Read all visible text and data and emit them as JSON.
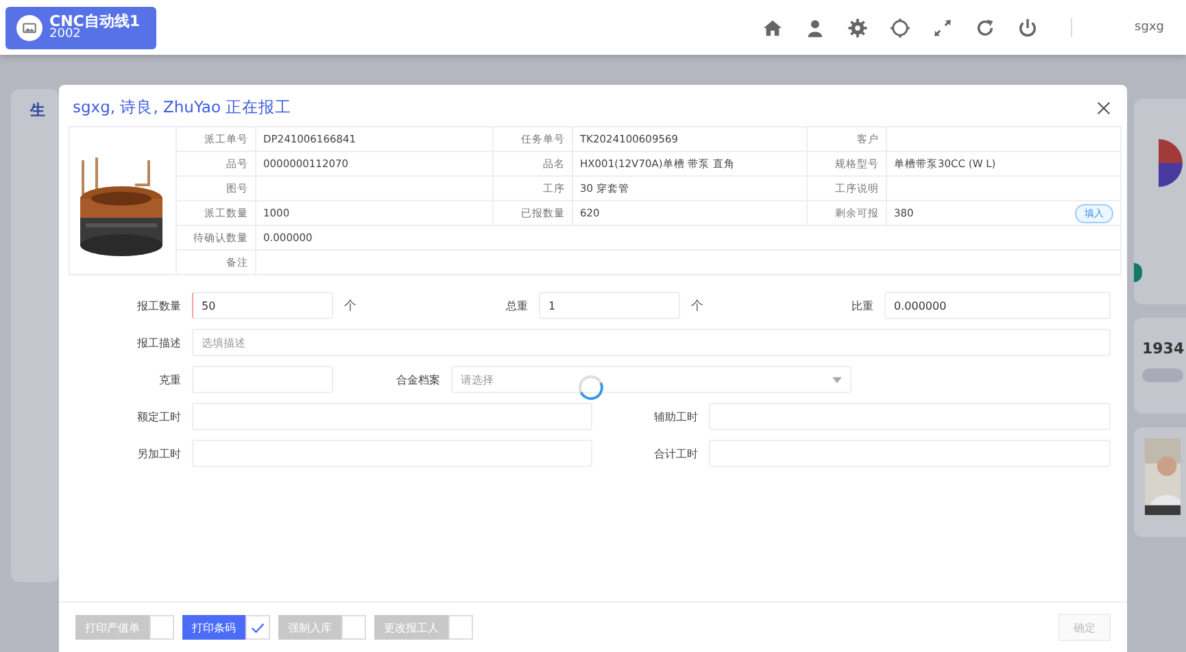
{
  "header": {
    "title": "CNC自动线1",
    "subtitle": "2002",
    "user": "sgxg"
  },
  "background": {
    "left_heading": "生",
    "right_reading": "1934"
  },
  "dialog": {
    "title": "sgxg, 诗良, ZhuYao 正在报工",
    "loading": true,
    "info_rows": [
      [
        {
          "label": "派工单号",
          "value": "DP241006166841"
        },
        {
          "label": "任务单号",
          "value": "TK2024100609569"
        },
        {
          "label": "客户"
        }
      ],
      [
        {
          "label": "品号",
          "value": "0000000112070"
        },
        {
          "label": "品名",
          "value": "HX001(12V70A)单槽 带泵 直角"
        },
        {
          "label": "规格型号",
          "value": "单槽带泵30CC (W L)"
        }
      ],
      [
        {
          "label": "图号"
        },
        {
          "label": "工序",
          "value": "30 穿套管"
        },
        {
          "label": "工序说明"
        }
      ],
      [
        {
          "label": "派工数量",
          "value": "1000"
        },
        {
          "label": "已报数量",
          "value": "620"
        },
        {
          "label": "剩余可报",
          "value": "380",
          "action": "填入"
        }
      ],
      [
        {
          "label": "待确认数量",
          "value": "0.000000"
        }
      ],
      [
        {
          "label": "备注"
        }
      ]
    ],
    "form": [
      [
        {
          "kind": "input",
          "label": "报工数量",
          "value": "50",
          "unit": "个",
          "required": true
        },
        {
          "kind": "input",
          "label": "总重",
          "value": "1",
          "unit": "个"
        },
        {
          "kind": "input",
          "label": "比重",
          "value": "0.000000"
        }
      ],
      [
        {
          "kind": "input",
          "label": "报工描述",
          "placeholder": "选填描述"
        }
      ],
      [
        {
          "kind": "input",
          "label": "克重"
        },
        {
          "kind": "select",
          "label": "合金档案",
          "placeholder": "请选择"
        }
      ],
      [
        {
          "kind": "input",
          "label": "额定工时"
        },
        {
          "kind": "input",
          "label": "辅助工时"
        }
      ],
      [
        {
          "kind": "input",
          "label": "另加工时"
        },
        {
          "kind": "input",
          "label": "合计工时"
        }
      ]
    ],
    "toggles": [
      {
        "label": "打印产值单",
        "checked": false
      },
      {
        "label": "打印条码",
        "checked": true
      },
      {
        "label": "强制入库",
        "checked": false
      },
      {
        "label": "更改报工人",
        "checked": false
      }
    ],
    "confirm": {
      "label": "确定",
      "disabled": true
    }
  }
}
